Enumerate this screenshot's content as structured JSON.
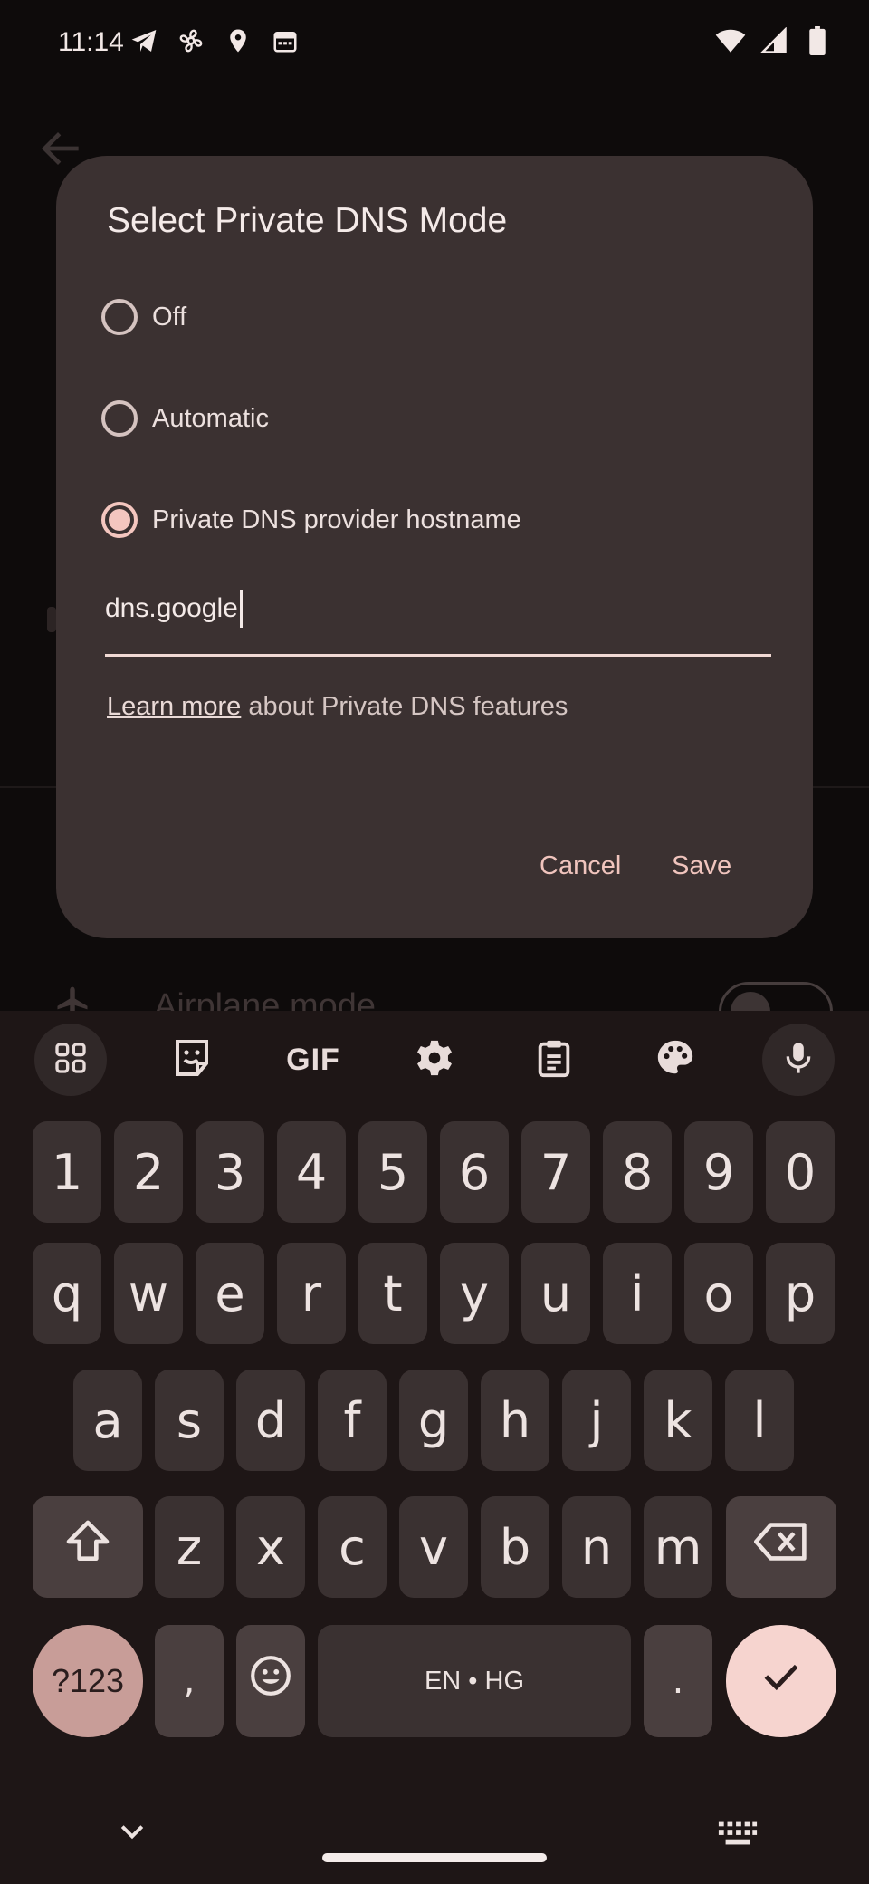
{
  "status_bar": {
    "time": "11:14",
    "left_icons": [
      "telegram-icon",
      "fan-icon",
      "location-icon",
      "calendar-icon"
    ],
    "right_icons": [
      "wifi-icon",
      "signal-icon",
      "battery-icon"
    ]
  },
  "background": {
    "airplane_mode_label": "Airplane mode"
  },
  "dialog": {
    "title": "Select Private DNS Mode",
    "options": [
      {
        "label": "Off",
        "selected": false
      },
      {
        "label": "Automatic",
        "selected": false
      },
      {
        "label": "Private DNS provider hostname",
        "selected": true
      }
    ],
    "hostname_value": "dns.google",
    "learn_more_link": "Learn more",
    "learn_more_rest": " about Private DNS features",
    "cancel_label": "Cancel",
    "save_label": "Save"
  },
  "keyboard": {
    "toolbar": [
      "apps-grid-icon",
      "sticker-icon",
      "gif-icon",
      "settings-gear-icon",
      "clipboard-icon",
      "palette-icon",
      "microphone-icon"
    ],
    "toolbar_gif_label": "GIF",
    "row_numbers": [
      "1",
      "2",
      "3",
      "4",
      "5",
      "6",
      "7",
      "8",
      "9",
      "0"
    ],
    "row_1": [
      "q",
      "w",
      "e",
      "r",
      "t",
      "y",
      "u",
      "i",
      "o",
      "p"
    ],
    "row_2": [
      "a",
      "s",
      "d",
      "f",
      "g",
      "h",
      "j",
      "k",
      "l"
    ],
    "row_3": [
      "z",
      "x",
      "c",
      "v",
      "b",
      "n",
      "m"
    ],
    "symbols_label": "?123",
    "comma_label": ",",
    "space_label": "EN • HG",
    "period_label": "."
  },
  "colors": {
    "accent": "#f4c6bf",
    "dialog_bg": "#3b3131",
    "keyboard_bg": "#1e1616",
    "key_bg": "#3a3131"
  }
}
